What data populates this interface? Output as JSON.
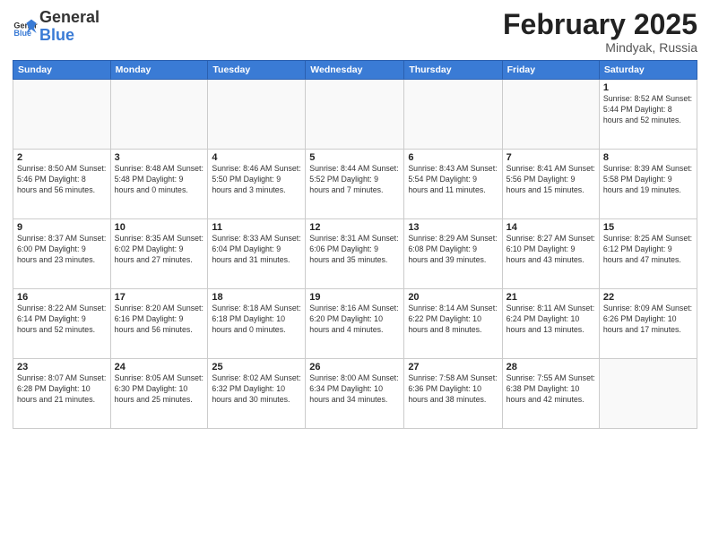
{
  "header": {
    "logo_general": "General",
    "logo_blue": "Blue",
    "month_title": "February 2025",
    "location": "Mindyak, Russia"
  },
  "days_of_week": [
    "Sunday",
    "Monday",
    "Tuesday",
    "Wednesday",
    "Thursday",
    "Friday",
    "Saturday"
  ],
  "weeks": [
    [
      {
        "num": "",
        "info": ""
      },
      {
        "num": "",
        "info": ""
      },
      {
        "num": "",
        "info": ""
      },
      {
        "num": "",
        "info": ""
      },
      {
        "num": "",
        "info": ""
      },
      {
        "num": "",
        "info": ""
      },
      {
        "num": "1",
        "info": "Sunrise: 8:52 AM\nSunset: 5:44 PM\nDaylight: 8 hours and 52 minutes."
      }
    ],
    [
      {
        "num": "2",
        "info": "Sunrise: 8:50 AM\nSunset: 5:46 PM\nDaylight: 8 hours and 56 minutes."
      },
      {
        "num": "3",
        "info": "Sunrise: 8:48 AM\nSunset: 5:48 PM\nDaylight: 9 hours and 0 minutes."
      },
      {
        "num": "4",
        "info": "Sunrise: 8:46 AM\nSunset: 5:50 PM\nDaylight: 9 hours and 3 minutes."
      },
      {
        "num": "5",
        "info": "Sunrise: 8:44 AM\nSunset: 5:52 PM\nDaylight: 9 hours and 7 minutes."
      },
      {
        "num": "6",
        "info": "Sunrise: 8:43 AM\nSunset: 5:54 PM\nDaylight: 9 hours and 11 minutes."
      },
      {
        "num": "7",
        "info": "Sunrise: 8:41 AM\nSunset: 5:56 PM\nDaylight: 9 hours and 15 minutes."
      },
      {
        "num": "8",
        "info": "Sunrise: 8:39 AM\nSunset: 5:58 PM\nDaylight: 9 hours and 19 minutes."
      }
    ],
    [
      {
        "num": "9",
        "info": "Sunrise: 8:37 AM\nSunset: 6:00 PM\nDaylight: 9 hours and 23 minutes."
      },
      {
        "num": "10",
        "info": "Sunrise: 8:35 AM\nSunset: 6:02 PM\nDaylight: 9 hours and 27 minutes."
      },
      {
        "num": "11",
        "info": "Sunrise: 8:33 AM\nSunset: 6:04 PM\nDaylight: 9 hours and 31 minutes."
      },
      {
        "num": "12",
        "info": "Sunrise: 8:31 AM\nSunset: 6:06 PM\nDaylight: 9 hours and 35 minutes."
      },
      {
        "num": "13",
        "info": "Sunrise: 8:29 AM\nSunset: 6:08 PM\nDaylight: 9 hours and 39 minutes."
      },
      {
        "num": "14",
        "info": "Sunrise: 8:27 AM\nSunset: 6:10 PM\nDaylight: 9 hours and 43 minutes."
      },
      {
        "num": "15",
        "info": "Sunrise: 8:25 AM\nSunset: 6:12 PM\nDaylight: 9 hours and 47 minutes."
      }
    ],
    [
      {
        "num": "16",
        "info": "Sunrise: 8:22 AM\nSunset: 6:14 PM\nDaylight: 9 hours and 52 minutes."
      },
      {
        "num": "17",
        "info": "Sunrise: 8:20 AM\nSunset: 6:16 PM\nDaylight: 9 hours and 56 minutes."
      },
      {
        "num": "18",
        "info": "Sunrise: 8:18 AM\nSunset: 6:18 PM\nDaylight: 10 hours and 0 minutes."
      },
      {
        "num": "19",
        "info": "Sunrise: 8:16 AM\nSunset: 6:20 PM\nDaylight: 10 hours and 4 minutes."
      },
      {
        "num": "20",
        "info": "Sunrise: 8:14 AM\nSunset: 6:22 PM\nDaylight: 10 hours and 8 minutes."
      },
      {
        "num": "21",
        "info": "Sunrise: 8:11 AM\nSunset: 6:24 PM\nDaylight: 10 hours and 13 minutes."
      },
      {
        "num": "22",
        "info": "Sunrise: 8:09 AM\nSunset: 6:26 PM\nDaylight: 10 hours and 17 minutes."
      }
    ],
    [
      {
        "num": "23",
        "info": "Sunrise: 8:07 AM\nSunset: 6:28 PM\nDaylight: 10 hours and 21 minutes."
      },
      {
        "num": "24",
        "info": "Sunrise: 8:05 AM\nSunset: 6:30 PM\nDaylight: 10 hours and 25 minutes."
      },
      {
        "num": "25",
        "info": "Sunrise: 8:02 AM\nSunset: 6:32 PM\nDaylight: 10 hours and 30 minutes."
      },
      {
        "num": "26",
        "info": "Sunrise: 8:00 AM\nSunset: 6:34 PM\nDaylight: 10 hours and 34 minutes."
      },
      {
        "num": "27",
        "info": "Sunrise: 7:58 AM\nSunset: 6:36 PM\nDaylight: 10 hours and 38 minutes."
      },
      {
        "num": "28",
        "info": "Sunrise: 7:55 AM\nSunset: 6:38 PM\nDaylight: 10 hours and 42 minutes."
      },
      {
        "num": "",
        "info": ""
      }
    ]
  ]
}
